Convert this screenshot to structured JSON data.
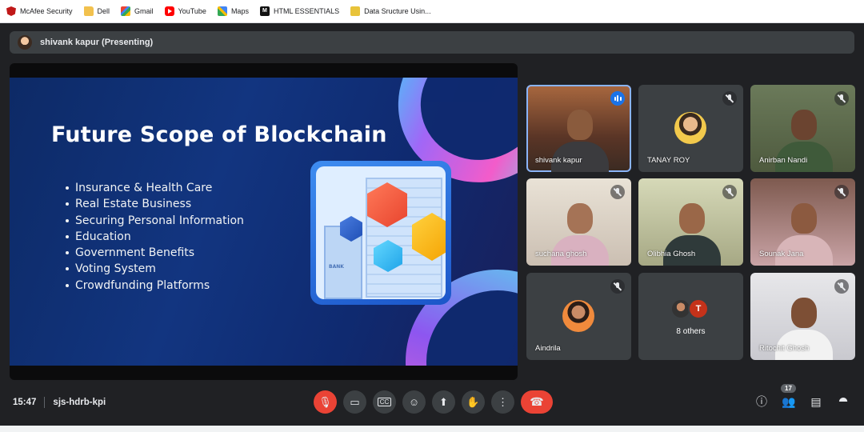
{
  "bookmarks": [
    {
      "label": "McAfee Security",
      "icon": "mcafee-icon"
    },
    {
      "label": "Dell",
      "icon": "folder-icon"
    },
    {
      "label": "Gmail",
      "icon": "gmail-icon"
    },
    {
      "label": "YouTube",
      "icon": "youtube-icon"
    },
    {
      "label": "Maps",
      "icon": "maps-icon"
    },
    {
      "label": "HTML ESSENTIALS",
      "icon": "html-icon"
    },
    {
      "label": "Data Sructure Usin...",
      "icon": "data-structure-icon"
    }
  ],
  "presenter": {
    "label": "shivank kapur (Presenting)"
  },
  "slide": {
    "title": "Future Scope of Blockchain",
    "bullets": [
      "Insurance & Health Care",
      "Real Estate Business",
      "Securing Personal Information",
      "Education",
      "Government Benefits",
      "Voting System",
      "Crowdfunding Platforms"
    ],
    "bank_label": "BANK"
  },
  "participants": [
    {
      "name": "shivank kapur",
      "status": "speaking"
    },
    {
      "name": "TANAY ROY",
      "status": "muted"
    },
    {
      "name": "Anirban Nandi",
      "status": "muted"
    },
    {
      "name": "suchana ghosh",
      "status": "muted"
    },
    {
      "name": "Olibhia Ghosh",
      "status": "muted"
    },
    {
      "name": "Sounak Jana",
      "status": "muted"
    },
    {
      "name": "Aindrila",
      "status": "muted"
    },
    {
      "name": "8 others",
      "avatar_letter": "T"
    },
    {
      "name": "Ritochit Ghosh",
      "status": "muted"
    }
  ],
  "meeting": {
    "time": "15:47",
    "code": "sjs-hdrb-kpi",
    "participant_count": "17"
  },
  "colors": {
    "accent": "#8ab4f8",
    "end_call": "#ea4335",
    "surface": "#3c4043",
    "background": "#202124"
  }
}
